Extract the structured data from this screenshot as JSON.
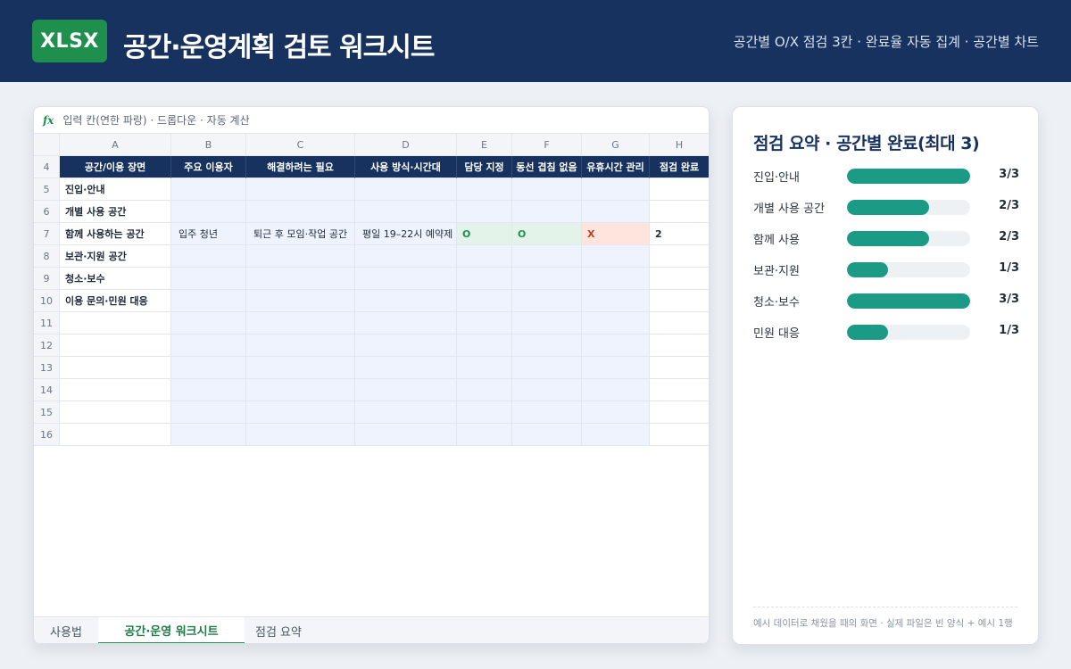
{
  "header": {
    "badge": "XLSX",
    "title": "공간·운영계획 검토 워크시트",
    "subtitle": "공간별 O/X 점검 3칸 · 완료율 자동 집계 · 공간별 차트"
  },
  "formula_bar": {
    "fx": "fx",
    "text": "입력 칸(연한 파랑) · 드롭다운 · 자동 계산"
  },
  "sheet": {
    "columns": [
      "A",
      "B",
      "C",
      "D",
      "E",
      "F",
      "G",
      "H"
    ],
    "header_row_number": "4",
    "headers": [
      "공간/이용 장면",
      "주요 이용자",
      "해결하려는 필요",
      "사용 방식·시간대",
      "담당 지정",
      "동선 겹침 없음",
      "유휴시간 관리",
      "점검 완료"
    ],
    "rows": [
      {
        "num": "5",
        "a": "진입·안내",
        "b": "",
        "c": "",
        "d": "",
        "e": "",
        "f": "",
        "g": "",
        "h": ""
      },
      {
        "num": "6",
        "a": "개별 사용 공간",
        "b": "",
        "c": "",
        "d": "",
        "e": "",
        "f": "",
        "g": "",
        "h": ""
      },
      {
        "num": "7",
        "a": "함께 사용하는 공간",
        "b": "입주 청년",
        "c": "퇴근 후 모임·작업 공간",
        "d": "평일 19–22시 예약제",
        "e": "O",
        "f": "O",
        "g": "X",
        "h": "2"
      },
      {
        "num": "8",
        "a": "보관·지원 공간",
        "b": "",
        "c": "",
        "d": "",
        "e": "",
        "f": "",
        "g": "",
        "h": ""
      },
      {
        "num": "9",
        "a": "청소·보수",
        "b": "",
        "c": "",
        "d": "",
        "e": "",
        "f": "",
        "g": "",
        "h": ""
      },
      {
        "num": "10",
        "a": "이용 문의·민원 대응",
        "b": "",
        "c": "",
        "d": "",
        "e": "",
        "f": "",
        "g": "",
        "h": ""
      },
      {
        "num": "11",
        "a": "",
        "b": "",
        "c": "",
        "d": "",
        "e": "",
        "f": "",
        "g": "",
        "h": ""
      },
      {
        "num": "12",
        "a": "",
        "b": "",
        "c": "",
        "d": "",
        "e": "",
        "f": "",
        "g": "",
        "h": ""
      },
      {
        "num": "13",
        "a": "",
        "b": "",
        "c": "",
        "d": "",
        "e": "",
        "f": "",
        "g": "",
        "h": ""
      },
      {
        "num": "14",
        "a": "",
        "b": "",
        "c": "",
        "d": "",
        "e": "",
        "f": "",
        "g": "",
        "h": ""
      },
      {
        "num": "15",
        "a": "",
        "b": "",
        "c": "",
        "d": "",
        "e": "",
        "f": "",
        "g": "",
        "h": ""
      },
      {
        "num": "16",
        "a": "",
        "b": "",
        "c": "",
        "d": "",
        "e": "",
        "f": "",
        "g": "",
        "h": ""
      }
    ],
    "tabs": [
      "사용법",
      "공간·운영 워크시트",
      "점검 요약"
    ],
    "active_tab": 1
  },
  "summary": {
    "title": "점검 요약 · 공간별 완료(최대 3)",
    "items": [
      {
        "label": "진입·안내",
        "value": "3/3",
        "done": 3,
        "max": 3
      },
      {
        "label": "개별 사용 공간",
        "value": "2/3",
        "done": 2,
        "max": 3
      },
      {
        "label": "함께 사용",
        "value": "2/3",
        "done": 2,
        "max": 3
      },
      {
        "label": "보관·지원",
        "value": "1/3",
        "done": 1,
        "max": 3
      },
      {
        "label": "청소·보수",
        "value": "3/3",
        "done": 3,
        "max": 3
      },
      {
        "label": "민원 대응",
        "value": "1/3",
        "done": 1,
        "max": 3
      }
    ],
    "note": "예시 데이터로 채웠을 때의 화면 · 실제 파일은 빈 양식 + 예시 1행"
  },
  "colors": {
    "header_bg": "#17325f",
    "badge_green": "#1f8f4e",
    "bar_fill": "#1b9a86",
    "input_blue": "#eef3fd",
    "ok_bg": "#e3f3ea",
    "x_bg": "#fde4dc"
  }
}
